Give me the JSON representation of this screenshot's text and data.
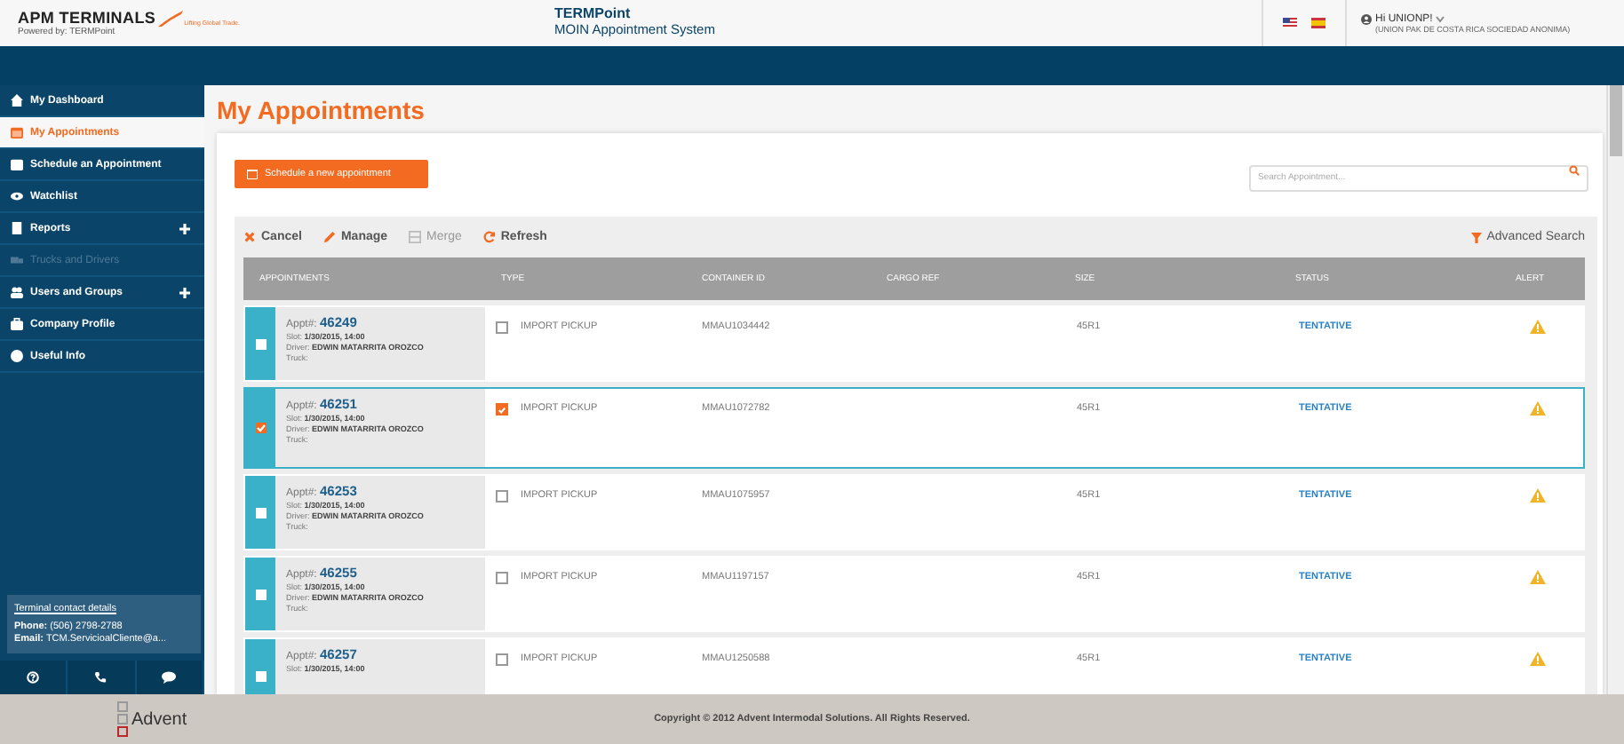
{
  "header": {
    "brand": "APM TERMINALS",
    "tagline": "Lifting Global Trade.",
    "powered_by": "Powered by: TERMPoint",
    "app_name": "TERMPoint",
    "app_subtitle": "MOIN Appointment System",
    "greeting": "Hi UNIONP!",
    "company": "(UNION PAK DE COSTA RICA SOCIEDAD ANONIMA)"
  },
  "sidebar": {
    "items": [
      {
        "label": "My Dashboard",
        "selected": false,
        "disabled": false,
        "expandable": false
      },
      {
        "label": "My Appointments",
        "selected": true,
        "disabled": false,
        "expandable": false
      },
      {
        "label": "Schedule an Appointment",
        "selected": false,
        "disabled": false,
        "expandable": false
      },
      {
        "label": "Watchlist",
        "selected": false,
        "disabled": false,
        "expandable": false
      },
      {
        "label": "Reports",
        "selected": false,
        "disabled": false,
        "expandable": true
      },
      {
        "label": "Trucks and Drivers",
        "selected": false,
        "disabled": true,
        "expandable": false
      },
      {
        "label": "Users and Groups",
        "selected": false,
        "disabled": false,
        "expandable": true
      },
      {
        "label": "Company Profile",
        "selected": false,
        "disabled": false,
        "expandable": false
      },
      {
        "label": "Useful Info",
        "selected": false,
        "disabled": false,
        "expandable": false
      }
    ],
    "contact": {
      "title": "Terminal contact details",
      "phone_label": "Phone:",
      "phone": "(506) 2798-2788",
      "email_label": "Email:",
      "email": "TCM.ServicioalCliente@a..."
    }
  },
  "page_title": "My Appointments",
  "new_button": "Schedule a new appointment",
  "search": {
    "placeholder": "Search Appointment..."
  },
  "toolbar": {
    "actions": [
      {
        "label": "Cancel",
        "disabled": false
      },
      {
        "label": "Manage",
        "disabled": false
      },
      {
        "label": "Merge",
        "disabled": true
      },
      {
        "label": "Refresh",
        "disabled": false
      }
    ],
    "advanced_search": "Advanced Search"
  },
  "table": {
    "columns": [
      "APPOINTMENTS",
      "TYPE",
      "CONTAINER ID",
      "CARGO REF",
      "SIZE",
      "STATUS",
      "ALERT"
    ],
    "rows": [
      {
        "selected": false,
        "appt_label": "Appt#:",
        "appt": "46249",
        "slot_label": "Slot:",
        "slot": "1/30/2015, 14:00",
        "driver_label": "Driver:",
        "driver": "EDWIN MATARRITA OROZCO",
        "truck_label": "Truck:",
        "type_checked": false,
        "type": "IMPORT PICKUP",
        "container": "MMAU1034442",
        "size": "45R1",
        "status": "TENTATIVE"
      },
      {
        "selected": true,
        "appt_label": "Appt#:",
        "appt": "46251",
        "slot_label": "Slot:",
        "slot": "1/30/2015, 14:00",
        "driver_label": "Driver:",
        "driver": "EDWIN MATARRITA OROZCO",
        "truck_label": "Truck:",
        "type_checked": true,
        "type": "IMPORT PICKUP",
        "container": "MMAU1072782",
        "size": "45R1",
        "status": "TENTATIVE"
      },
      {
        "selected": false,
        "appt_label": "Appt#:",
        "appt": "46253",
        "slot_label": "Slot:",
        "slot": "1/30/2015, 14:00",
        "driver_label": "Driver:",
        "driver": "EDWIN MATARRITA OROZCO",
        "truck_label": "Truck:",
        "type_checked": false,
        "type": "IMPORT PICKUP",
        "container": "MMAU1075957",
        "size": "45R1",
        "status": "TENTATIVE"
      },
      {
        "selected": false,
        "appt_label": "Appt#:",
        "appt": "46255",
        "slot_label": "Slot:",
        "slot": "1/30/2015, 14:00",
        "driver_label": "Driver:",
        "driver": "EDWIN MATARRITA OROZCO",
        "truck_label": "Truck:",
        "type_checked": false,
        "type": "IMPORT PICKUP",
        "container": "MMAU1197157",
        "size": "45R1",
        "status": "TENTATIVE"
      },
      {
        "selected": false,
        "appt_label": "Appt#:",
        "appt": "46257",
        "slot_label": "Slot:",
        "slot": "1/30/2015, 14:00",
        "type_checked": false,
        "type": "IMPORT PICKUP",
        "container": "MMAU1250588",
        "size": "45R1",
        "status": "TENTATIVE"
      }
    ]
  },
  "footer": {
    "logo": "Advent",
    "copyright": "Copyright © 2012 Advent Intermodal Solutions. All Rights Reserved."
  }
}
